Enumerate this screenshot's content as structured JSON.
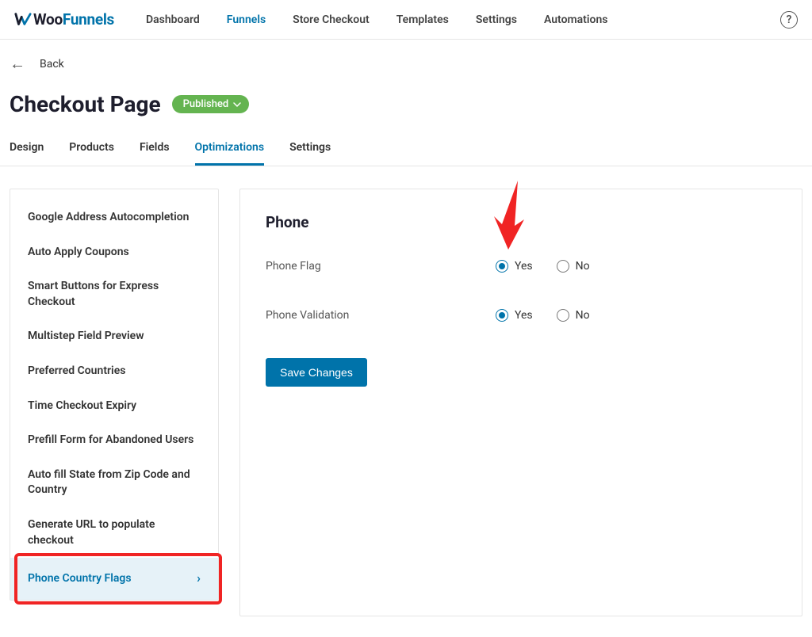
{
  "logo": {
    "text1": "Woo",
    "text2": "Funnels"
  },
  "nav": {
    "items": [
      "Dashboard",
      "Funnels",
      "Store Checkout",
      "Templates",
      "Settings",
      "Automations"
    ],
    "active_index": 1
  },
  "back": {
    "label": "Back"
  },
  "page": {
    "title": "Checkout Page",
    "status": "Published"
  },
  "tabs": {
    "items": [
      "Design",
      "Products",
      "Fields",
      "Optimizations",
      "Settings"
    ],
    "active_index": 3
  },
  "sidebar": {
    "items": [
      "Google Address Autocompletion",
      "Auto Apply Coupons",
      "Smart Buttons for Express Checkout",
      "Multistep Field Preview",
      "Preferred Countries",
      "Time Checkout Expiry",
      "Prefill Form for Abandoned Users",
      "Auto fill State from Zip Code and Country",
      "Generate URL to populate checkout",
      "Phone Country Flags"
    ],
    "active_index": 9
  },
  "panel": {
    "title": "Phone",
    "fields": [
      {
        "label": "Phone Flag",
        "options": [
          "Yes",
          "No"
        ],
        "selected": "Yes"
      },
      {
        "label": "Phone Validation",
        "options": [
          "Yes",
          "No"
        ],
        "selected": "Yes"
      }
    ],
    "save_label": "Save Changes"
  }
}
